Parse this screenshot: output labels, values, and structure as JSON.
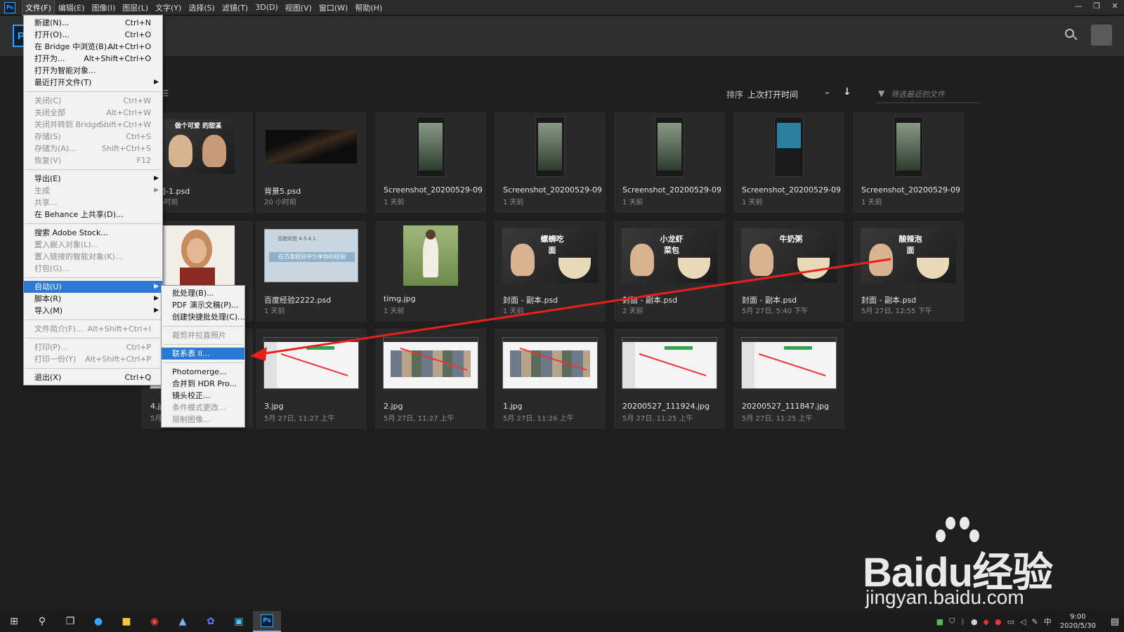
{
  "menubar": {
    "logo": "Ps",
    "items": [
      "文件(F)",
      "编辑(E)",
      "图像(I)",
      "图层(L)",
      "文字(Y)",
      "选择(S)",
      "滤镜(T)",
      "3D(D)",
      "视图(V)",
      "窗口(W)",
      "帮助(H)"
    ],
    "window_controls": [
      "—",
      "❐",
      "✕"
    ]
  },
  "header": {
    "logo": "Ps"
  },
  "toolbar": {
    "sort_label": "排序",
    "sort_value": "上次打开时间",
    "filter_placeholder": "筛选最近的文件"
  },
  "files": [
    {
      "name": "封面-1.psd",
      "date": "1 小时前",
      "kind": "cover-people"
    },
    {
      "name": "背景5.psd",
      "date": "20 小时前",
      "kind": "dark"
    },
    {
      "name": "Screenshot_20200529-093...",
      "date": "1 天前",
      "kind": "phone"
    },
    {
      "name": "Screenshot_20200529-093...",
      "date": "1 天前",
      "kind": "phone"
    },
    {
      "name": "Screenshot_20200529-093...",
      "date": "1 天前",
      "kind": "phone"
    },
    {
      "name": "Screenshot_20200529-093...",
      "date": "1 天前",
      "kind": "phone-blue"
    },
    {
      "name": "Screenshot_20200529-093...",
      "date": "1 天前",
      "kind": "phone"
    },
    {
      "name": "",
      "date": "",
      "kind": "portrait"
    },
    {
      "name": "百度经验2222.psd",
      "date": "1 天前",
      "kind": "baidu"
    },
    {
      "name": "timg.jpg",
      "date": "1 天前",
      "kind": "field"
    },
    {
      "name": "封面 - 副本.psd",
      "date": "1 天前",
      "kind": "food",
      "title": "螺蛳吃面"
    },
    {
      "name": "封面 - 副本.psd",
      "date": "2 天前",
      "kind": "food",
      "title": "小龙虾菜包"
    },
    {
      "name": "封面 - 副本.psd",
      "date": "5月 27日, 5:40 下午",
      "kind": "food",
      "title": "牛奶粥"
    },
    {
      "name": "封面 - 副本.psd",
      "date": "5月 27日, 12:55 下午",
      "kind": "food",
      "title": "酸辣泡面"
    },
    {
      "name": "4.jpg",
      "date": "5月",
      "kind": "screen"
    },
    {
      "name": "3.jpg",
      "date": "5月 27日, 11:27 上午",
      "kind": "screen"
    },
    {
      "name": "2.jpg",
      "date": "5月 27日, 11:27 上午",
      "kind": "screen-imgs"
    },
    {
      "name": "1.jpg",
      "date": "5月 27日, 11:26 上午",
      "kind": "screen-imgs"
    },
    {
      "name": "20200527_111924.jpg",
      "date": "5月 27日, 11:25 上午",
      "kind": "screen"
    },
    {
      "name": "20200527_111847.jpg",
      "date": "5月 27日, 11:25 上午",
      "kind": "screen"
    }
  ],
  "file_menu": [
    {
      "label": "新建(N)...",
      "shortcut": "Ctrl+N"
    },
    {
      "label": "打开(O)...",
      "shortcut": "Ctrl+O"
    },
    {
      "label": "在 Bridge 中浏览(B)...",
      "shortcut": "Alt+Ctrl+O"
    },
    {
      "label": "打开为...",
      "shortcut": "Alt+Shift+Ctrl+O"
    },
    {
      "label": "打开为智能对象..."
    },
    {
      "label": "最近打开文件(T)",
      "submenu": true
    },
    {
      "sep": true
    },
    {
      "label": "关闭(C)",
      "shortcut": "Ctrl+W",
      "disabled": true
    },
    {
      "label": "关闭全部",
      "shortcut": "Alt+Ctrl+W",
      "disabled": true
    },
    {
      "label": "关闭并转到 Bridge...",
      "shortcut": "Shift+Ctrl+W",
      "disabled": true
    },
    {
      "label": "存储(S)",
      "shortcut": "Ctrl+S",
      "disabled": true
    },
    {
      "label": "存储为(A)...",
      "shortcut": "Shift+Ctrl+S",
      "disabled": true
    },
    {
      "label": "恢复(V)",
      "shortcut": "F12",
      "disabled": true
    },
    {
      "sep": true
    },
    {
      "label": "导出(E)",
      "submenu": true
    },
    {
      "label": "生成",
      "submenu": true,
      "disabled": true
    },
    {
      "label": "共享...",
      "disabled": true
    },
    {
      "label": "在 Behance 上共享(D)..."
    },
    {
      "sep": true
    },
    {
      "label": "搜索 Adobe Stock..."
    },
    {
      "label": "置入嵌入对象(L)...",
      "disabled": true
    },
    {
      "label": "置入链接的智能对象(K)...",
      "disabled": true
    },
    {
      "label": "打包(G)...",
      "disabled": true
    },
    {
      "sep": true
    },
    {
      "label": "自动(U)",
      "submenu": true,
      "highlight": true
    },
    {
      "label": "脚本(R)",
      "submenu": true
    },
    {
      "label": "导入(M)",
      "submenu": true
    },
    {
      "sep": true
    },
    {
      "label": "文件简介(F)...",
      "shortcut": "Alt+Shift+Ctrl+I",
      "disabled": true
    },
    {
      "sep": true
    },
    {
      "label": "打印(P)...",
      "shortcut": "Ctrl+P",
      "disabled": true
    },
    {
      "label": "打印一份(Y)",
      "shortcut": "Alt+Shift+Ctrl+P",
      "disabled": true
    },
    {
      "sep": true
    },
    {
      "label": "退出(X)",
      "shortcut": "Ctrl+Q"
    }
  ],
  "automate_menu": [
    {
      "label": "批处理(B)..."
    },
    {
      "label": "PDF 演示文稿(P)..."
    },
    {
      "label": "创建快捷批处理(C)..."
    },
    {
      "sep": true
    },
    {
      "label": "裁剪并拉直照片",
      "disabled": true
    },
    {
      "sep": true
    },
    {
      "label": "联系表 II...",
      "highlight": true
    },
    {
      "sep": true
    },
    {
      "label": "Photomerge..."
    },
    {
      "label": "合并到 HDR Pro..."
    },
    {
      "label": "镜头校正..."
    },
    {
      "label": "条件模式更改...",
      "disabled": true
    },
    {
      "label": "限制图像...",
      "disabled": true
    }
  ],
  "cover_texts": {
    "cover1_a": "做个可爱",
    "cover1_b": "的甜溪",
    "baidu_small": "百度经验 4.5.4.1",
    "baidu_big": "在百度经验中分享你的经验"
  },
  "watermark": {
    "top": "Baidu经验",
    "bottom": "jingyan.baidu.com"
  },
  "taskbar": {
    "icons": [
      "windows-icon",
      "search-icon",
      "task-view-icon",
      "edge-icon",
      "folder-icon",
      "chrome-icon",
      "app-icon",
      "baidu-icon",
      "store-icon",
      "photoshop-icon"
    ],
    "tray_lang": "中",
    "clock_time": "9:00",
    "clock_date": "2020/5/30"
  },
  "colors": {
    "accent": "#2a7ad5",
    "ps_blue": "#31a8ff",
    "arrow": "#e8201c"
  }
}
